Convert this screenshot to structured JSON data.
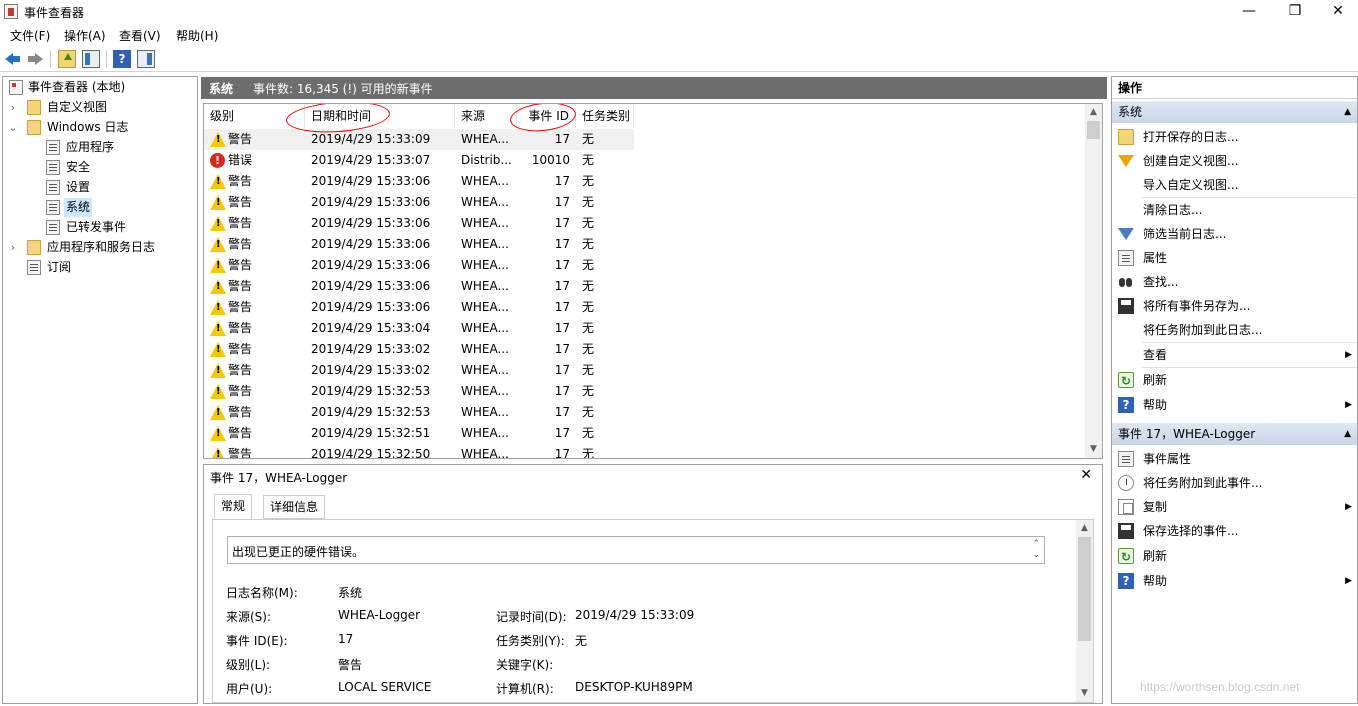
{
  "window": {
    "title": "事件查看器",
    "minimize": "—",
    "maximize": "❐",
    "close": "✕"
  },
  "menu": [
    "文件(F)",
    "操作(A)",
    "查看(V)",
    "帮助(H)"
  ],
  "toolbar": {
    "help_glyph": "?"
  },
  "tree": {
    "root": "事件查看器 (本地)",
    "custom_views": "自定义视图",
    "windows_logs": "Windows 日志",
    "app_log": "应用程序",
    "security_log": "安全",
    "setup_log": "设置",
    "system_log": "系统",
    "forwarded_events": "已转发事件",
    "app_service_logs": "应用程序和服务日志",
    "subscriptions": "订阅"
  },
  "center": {
    "log_name": "系统",
    "event_count": "事件数: 16,345 (!) 可用的新事件"
  },
  "columns": {
    "level": "级别",
    "datetime": "日期和时间",
    "source": "来源",
    "event_id": "事件 ID",
    "category": "任务类别"
  },
  "events": [
    {
      "level": "警告",
      "type": "warning",
      "datetime": "2019/4/29 15:33:09",
      "source": "WHEA...",
      "id": "17",
      "category": "无"
    },
    {
      "level": "错误",
      "type": "error",
      "datetime": "2019/4/29 15:33:07",
      "source": "Distrib...",
      "id": "10010",
      "category": "无"
    },
    {
      "level": "警告",
      "type": "warning",
      "datetime": "2019/4/29 15:33:06",
      "source": "WHEA...",
      "id": "17",
      "category": "无"
    },
    {
      "level": "警告",
      "type": "warning",
      "datetime": "2019/4/29 15:33:06",
      "source": "WHEA...",
      "id": "17",
      "category": "无"
    },
    {
      "level": "警告",
      "type": "warning",
      "datetime": "2019/4/29 15:33:06",
      "source": "WHEA...",
      "id": "17",
      "category": "无"
    },
    {
      "level": "警告",
      "type": "warning",
      "datetime": "2019/4/29 15:33:06",
      "source": "WHEA...",
      "id": "17",
      "category": "无"
    },
    {
      "level": "警告",
      "type": "warning",
      "datetime": "2019/4/29 15:33:06",
      "source": "WHEA...",
      "id": "17",
      "category": "无"
    },
    {
      "level": "警告",
      "type": "warning",
      "datetime": "2019/4/29 15:33:06",
      "source": "WHEA...",
      "id": "17",
      "category": "无"
    },
    {
      "level": "警告",
      "type": "warning",
      "datetime": "2019/4/29 15:33:06",
      "source": "WHEA...",
      "id": "17",
      "category": "无"
    },
    {
      "level": "警告",
      "type": "warning",
      "datetime": "2019/4/29 15:33:04",
      "source": "WHEA...",
      "id": "17",
      "category": "无"
    },
    {
      "level": "警告",
      "type": "warning",
      "datetime": "2019/4/29 15:33:02",
      "source": "WHEA...",
      "id": "17",
      "category": "无"
    },
    {
      "level": "警告",
      "type": "warning",
      "datetime": "2019/4/29 15:33:02",
      "source": "WHEA...",
      "id": "17",
      "category": "无"
    },
    {
      "level": "警告",
      "type": "warning",
      "datetime": "2019/4/29 15:32:53",
      "source": "WHEA...",
      "id": "17",
      "category": "无"
    },
    {
      "level": "警告",
      "type": "warning",
      "datetime": "2019/4/29 15:32:53",
      "source": "WHEA...",
      "id": "17",
      "category": "无"
    },
    {
      "level": "警告",
      "type": "warning",
      "datetime": "2019/4/29 15:32:51",
      "source": "WHEA...",
      "id": "17",
      "category": "无"
    },
    {
      "level": "警告",
      "type": "warning",
      "datetime": "2019/4/29 15:32:50",
      "source": "WHEA...",
      "id": "17",
      "category": "无"
    }
  ],
  "detail": {
    "title": "事件 17，WHEA-Logger",
    "close": "✕",
    "tab_general": "常规",
    "tab_details": "详细信息",
    "message": "出现已更正的硬件错误。",
    "log_name_label": "日志名称(M):",
    "log_name_value": "系统",
    "source_label": "来源(S):",
    "source_value": "WHEA-Logger",
    "logged_label": "记录时间(D):",
    "logged_value": "2019/4/29 15:33:09",
    "event_id_label": "事件 ID(E):",
    "event_id_value": "17",
    "category_label": "任务类别(Y):",
    "category_value": "无",
    "level_label": "级别(L):",
    "level_value": "警告",
    "keywords_label": "关键字(K):",
    "keywords_value": "",
    "user_label": "用户(U):",
    "user_value": "LOCAL SERVICE",
    "computer_label": "计算机(R):",
    "computer_value": "DESKTOP-KUH89PM"
  },
  "actions": {
    "header": "操作",
    "section1": "系统",
    "open_saved": "打开保存的日志...",
    "create_custom": "创建自定义视图...",
    "import_custom": "导入自定义视图...",
    "clear_log": "清除日志...",
    "filter_log": "筛选当前日志...",
    "properties": "属性",
    "find": "查找...",
    "save_all": "将所有事件另存为...",
    "attach_task_log": "将任务附加到此日志...",
    "view": "查看",
    "refresh": "刷新",
    "help": "帮助",
    "section2": "事件 17，WHEA-Logger",
    "event_properties": "事件属性",
    "attach_task_event": "将任务附加到此事件...",
    "copy": "复制",
    "save_selected": "保存选择的事件...",
    "refresh2": "刷新",
    "help2": "帮助"
  },
  "watermark": "https://worthsen.blog.csdn.net"
}
